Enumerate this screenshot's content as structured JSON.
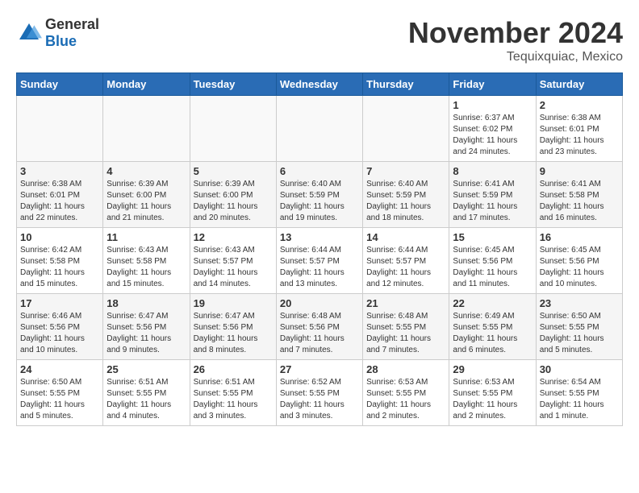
{
  "logo": {
    "general": "General",
    "blue": "Blue"
  },
  "title": "November 2024",
  "location": "Tequixquiac, Mexico",
  "days_header": [
    "Sunday",
    "Monday",
    "Tuesday",
    "Wednesday",
    "Thursday",
    "Friday",
    "Saturday"
  ],
  "weeks": [
    [
      {
        "day": "",
        "info": ""
      },
      {
        "day": "",
        "info": ""
      },
      {
        "day": "",
        "info": ""
      },
      {
        "day": "",
        "info": ""
      },
      {
        "day": "",
        "info": ""
      },
      {
        "day": "1",
        "info": "Sunrise: 6:37 AM\nSunset: 6:02 PM\nDaylight: 11 hours\nand 24 minutes."
      },
      {
        "day": "2",
        "info": "Sunrise: 6:38 AM\nSunset: 6:01 PM\nDaylight: 11 hours\nand 23 minutes."
      }
    ],
    [
      {
        "day": "3",
        "info": "Sunrise: 6:38 AM\nSunset: 6:01 PM\nDaylight: 11 hours\nand 22 minutes."
      },
      {
        "day": "4",
        "info": "Sunrise: 6:39 AM\nSunset: 6:00 PM\nDaylight: 11 hours\nand 21 minutes."
      },
      {
        "day": "5",
        "info": "Sunrise: 6:39 AM\nSunset: 6:00 PM\nDaylight: 11 hours\nand 20 minutes."
      },
      {
        "day": "6",
        "info": "Sunrise: 6:40 AM\nSunset: 5:59 PM\nDaylight: 11 hours\nand 19 minutes."
      },
      {
        "day": "7",
        "info": "Sunrise: 6:40 AM\nSunset: 5:59 PM\nDaylight: 11 hours\nand 18 minutes."
      },
      {
        "day": "8",
        "info": "Sunrise: 6:41 AM\nSunset: 5:59 PM\nDaylight: 11 hours\nand 17 minutes."
      },
      {
        "day": "9",
        "info": "Sunrise: 6:41 AM\nSunset: 5:58 PM\nDaylight: 11 hours\nand 16 minutes."
      }
    ],
    [
      {
        "day": "10",
        "info": "Sunrise: 6:42 AM\nSunset: 5:58 PM\nDaylight: 11 hours\nand 15 minutes."
      },
      {
        "day": "11",
        "info": "Sunrise: 6:43 AM\nSunset: 5:58 PM\nDaylight: 11 hours\nand 15 minutes."
      },
      {
        "day": "12",
        "info": "Sunrise: 6:43 AM\nSunset: 5:57 PM\nDaylight: 11 hours\nand 14 minutes."
      },
      {
        "day": "13",
        "info": "Sunrise: 6:44 AM\nSunset: 5:57 PM\nDaylight: 11 hours\nand 13 minutes."
      },
      {
        "day": "14",
        "info": "Sunrise: 6:44 AM\nSunset: 5:57 PM\nDaylight: 11 hours\nand 12 minutes."
      },
      {
        "day": "15",
        "info": "Sunrise: 6:45 AM\nSunset: 5:56 PM\nDaylight: 11 hours\nand 11 minutes."
      },
      {
        "day": "16",
        "info": "Sunrise: 6:45 AM\nSunset: 5:56 PM\nDaylight: 11 hours\nand 10 minutes."
      }
    ],
    [
      {
        "day": "17",
        "info": "Sunrise: 6:46 AM\nSunset: 5:56 PM\nDaylight: 11 hours\nand 10 minutes."
      },
      {
        "day": "18",
        "info": "Sunrise: 6:47 AM\nSunset: 5:56 PM\nDaylight: 11 hours\nand 9 minutes."
      },
      {
        "day": "19",
        "info": "Sunrise: 6:47 AM\nSunset: 5:56 PM\nDaylight: 11 hours\nand 8 minutes."
      },
      {
        "day": "20",
        "info": "Sunrise: 6:48 AM\nSunset: 5:56 PM\nDaylight: 11 hours\nand 7 minutes."
      },
      {
        "day": "21",
        "info": "Sunrise: 6:48 AM\nSunset: 5:55 PM\nDaylight: 11 hours\nand 7 minutes."
      },
      {
        "day": "22",
        "info": "Sunrise: 6:49 AM\nSunset: 5:55 PM\nDaylight: 11 hours\nand 6 minutes."
      },
      {
        "day": "23",
        "info": "Sunrise: 6:50 AM\nSunset: 5:55 PM\nDaylight: 11 hours\nand 5 minutes."
      }
    ],
    [
      {
        "day": "24",
        "info": "Sunrise: 6:50 AM\nSunset: 5:55 PM\nDaylight: 11 hours\nand 5 minutes."
      },
      {
        "day": "25",
        "info": "Sunrise: 6:51 AM\nSunset: 5:55 PM\nDaylight: 11 hours\nand 4 minutes."
      },
      {
        "day": "26",
        "info": "Sunrise: 6:51 AM\nSunset: 5:55 PM\nDaylight: 11 hours\nand 3 minutes."
      },
      {
        "day": "27",
        "info": "Sunrise: 6:52 AM\nSunset: 5:55 PM\nDaylight: 11 hours\nand 3 minutes."
      },
      {
        "day": "28",
        "info": "Sunrise: 6:53 AM\nSunset: 5:55 PM\nDaylight: 11 hours\nand 2 minutes."
      },
      {
        "day": "29",
        "info": "Sunrise: 6:53 AM\nSunset: 5:55 PM\nDaylight: 11 hours\nand 2 minutes."
      },
      {
        "day": "30",
        "info": "Sunrise: 6:54 AM\nSunset: 5:55 PM\nDaylight: 11 hours\nand 1 minute."
      }
    ]
  ]
}
